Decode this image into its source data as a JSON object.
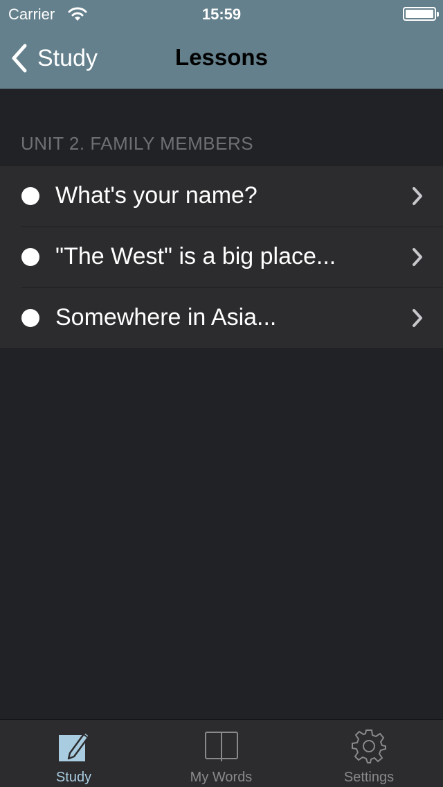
{
  "status_bar": {
    "carrier": "Carrier",
    "time": "15:59"
  },
  "nav": {
    "back_label": "Study",
    "title": "Lessons"
  },
  "section": {
    "header": "UNIT 2. FAMILY MEMBERS",
    "items": [
      {
        "label": "What's your name?"
      },
      {
        "label": "\"The West\" is a big place..."
      },
      {
        "label": "Somewhere in Asia..."
      }
    ]
  },
  "tabs": [
    {
      "label": "Study",
      "icon": "pencil-icon",
      "active": true
    },
    {
      "label": "My Words",
      "icon": "book-icon",
      "active": false
    },
    {
      "label": "Settings",
      "icon": "gear-icon",
      "active": false
    }
  ],
  "colors": {
    "nav_background": "#64808c",
    "content_background": "#212226",
    "active_tab": "#a9cce0"
  }
}
